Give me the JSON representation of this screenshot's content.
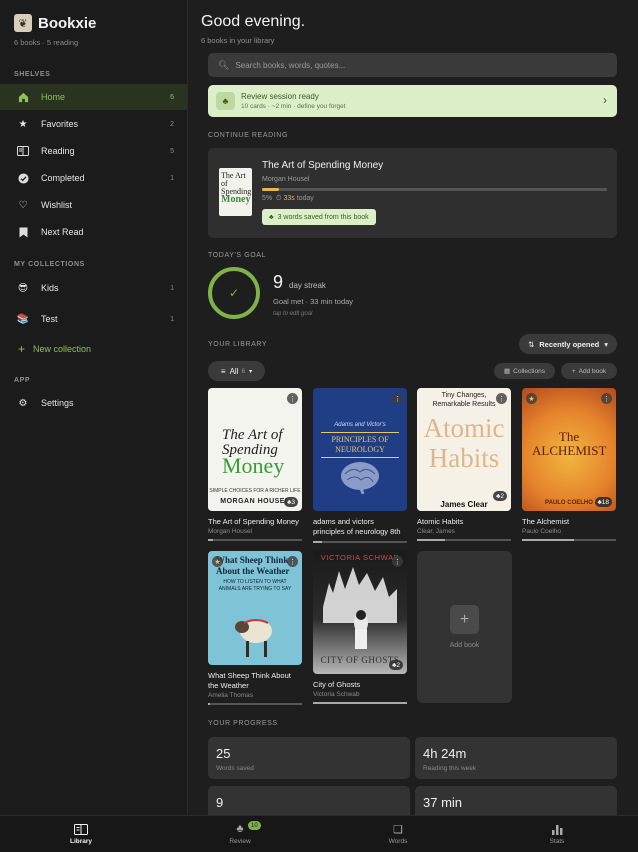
{
  "sidebar": {
    "app_name": "Bookxie",
    "subtitle": "6 books · 5 reading",
    "shelves_header": "SHELVES",
    "shelves": [
      {
        "label": "Home",
        "count": "6",
        "icon": "home-icon"
      },
      {
        "label": "Favorites",
        "count": "2",
        "icon": "star-icon"
      },
      {
        "label": "Reading",
        "count": "5",
        "icon": "reading-icon"
      },
      {
        "label": "Completed",
        "count": "1",
        "icon": "check-circle-icon"
      },
      {
        "label": "Wishlist",
        "count": "",
        "icon": "heart-icon"
      },
      {
        "label": "Next Read",
        "count": "",
        "icon": "bookmark-icon"
      }
    ],
    "collections_header": "MY COLLECTIONS",
    "collections": [
      {
        "label": "Kids",
        "count": "1",
        "icon": "sunglasses-emoji-icon"
      },
      {
        "label": "Test",
        "count": "1",
        "icon": "books-emoji-icon"
      }
    ],
    "new_collection": "New collection",
    "app_header": "APP",
    "settings": "Settings"
  },
  "header": {
    "greeting": "Good evening.",
    "subtitle": "6 books in your library"
  },
  "search": {
    "placeholder": "Search books, words, quotes..."
  },
  "review": {
    "title": "Review session ready",
    "subtitle": "10 cards · ~2 min · define you forget"
  },
  "continue": {
    "label": "CONTINUE READING",
    "title": "The Art of Spending Money",
    "author": "Morgan Housel",
    "progress": 0.05,
    "percent": "5%",
    "time_today": "33s",
    "today_suffix": "today",
    "chip": "3 words saved from this book"
  },
  "goal": {
    "label": "TODAY'S GOAL",
    "streak": "9",
    "streak_suffix": "day streak",
    "status": "Goal met · 33 min today",
    "hint": "tap to edit goal"
  },
  "library": {
    "label": "YOUR LIBRARY",
    "sort_label": "Recently opened",
    "filter_label": "All",
    "filter_count": "6",
    "collections_btn": "Collections",
    "add_btn": "Add book",
    "add_tile": "Add book",
    "books": [
      {
        "title": "The Art of Spending Money",
        "author": "Morgan Housel",
        "badge": "3",
        "progress": 0.05,
        "starred": false
      },
      {
        "title": "adams and victors principles of neurology 8th",
        "author": "",
        "badge": "",
        "progress": 0.1,
        "starred": false
      },
      {
        "title": "Atomic Habits",
        "author": "Clear, James",
        "badge": "2",
        "progress": 0.3,
        "starred": false
      },
      {
        "title": "The Alchemist",
        "author": "Paulo Coelho",
        "badge": "18",
        "progress": 0.55,
        "starred": true
      },
      {
        "title": "What Sheep Think About the Weather",
        "author": "Amelia Thomas",
        "badge": "",
        "progress": 0.02,
        "starred": true
      },
      {
        "title": "City of Ghosts",
        "author": "Victoria Schwab",
        "badge": "2",
        "progress": 1.0,
        "starred": false
      }
    ],
    "covers": {
      "c1_line1": "The Art of",
      "c1_line2": "Spending",
      "c1_line3": "Money",
      "c1_sub": "SIMPLE CHOICES FOR A RICHER LIFE",
      "c1_author": "MORGAN HOUSEL",
      "c2_top": "Adams and Victor's",
      "c2_title": "PRINCIPLES OF NEUROLOGY",
      "c3_top": "Tiny Changes, Remarkable Results",
      "c3_title1": "Atomic",
      "c3_title2": "Habits",
      "c3_author": "James Clear",
      "c4_title": "The ALCHEMIST",
      "c4_author": "PAULO COELHO",
      "c5_title": "What Sheep Think About the Weather",
      "c5_sub": "HOW TO LISTEN TO WHAT ANIMALS ARE TRYING TO SAY",
      "c6_author": "VICTORIA SCHWAB",
      "c6_title": "CITY OF GHOSTS"
    }
  },
  "progress": {
    "label": "YOUR PROGRESS",
    "stats": [
      {
        "value": "25",
        "label": "Words saved"
      },
      {
        "value": "4h 24m",
        "label": "Reading this week"
      },
      {
        "value": "9",
        "label": ""
      },
      {
        "value": "37 min",
        "label": ""
      }
    ]
  },
  "nav": [
    {
      "label": "Library",
      "icon": "library-icon"
    },
    {
      "label": "Review",
      "icon": "review-icon",
      "badge": "10"
    },
    {
      "label": "Words",
      "icon": "words-icon"
    },
    {
      "label": "Stats",
      "icon": "stats-icon"
    }
  ],
  "colors": {
    "accent": "#8fc05a",
    "gold": "#e6b84a",
    "review_bg": "#dcefc8"
  }
}
